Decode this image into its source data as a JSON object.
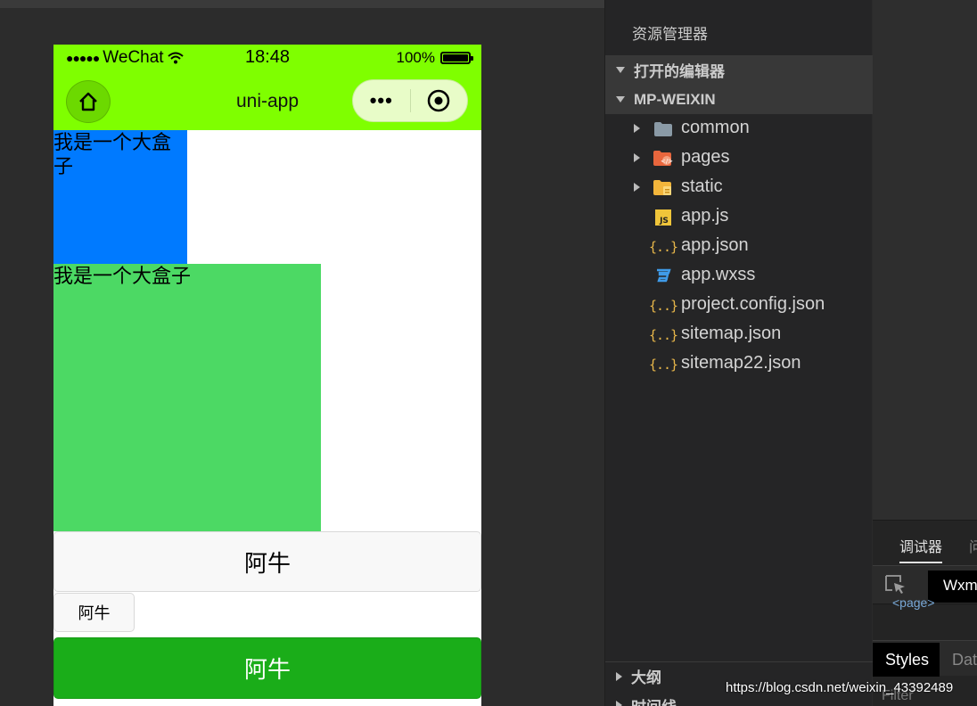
{
  "status_bar": {
    "carrier": "WeChat",
    "time": "18:48",
    "battery": "100%",
    "battery_level": 1.0
  },
  "nav_bar": {
    "title": "uni-app",
    "more_icon": "•••"
  },
  "content": {
    "blue_box_text": "我是一个大盒子",
    "green_box_text": "我是一个大盒子",
    "button_default": "阿牛",
    "button_mini": "阿牛",
    "button_primary": "阿牛"
  },
  "explorer": {
    "title": "资源管理器",
    "open_editors": "打开的编辑器",
    "project": "MP-WEIXIN",
    "files": [
      {
        "name": "common",
        "icon": "folder-icon"
      },
      {
        "name": "pages",
        "icon": "pages-folder-icon"
      },
      {
        "name": "static",
        "icon": "static-folder-icon"
      },
      {
        "name": "app.js",
        "icon": "js-icon"
      },
      {
        "name": "app.json",
        "icon": "json-icon"
      },
      {
        "name": "app.wxss",
        "icon": "css-icon"
      },
      {
        "name": "project.config.json",
        "icon": "json-icon"
      },
      {
        "name": "sitemap.json",
        "icon": "json-icon"
      },
      {
        "name": "sitemap22.json",
        "icon": "json-icon"
      }
    ],
    "outline": "大纲",
    "timeline": "时间线"
  },
  "devtools": {
    "tab_debugger": "调试器",
    "tab_next": "问",
    "wxml_tab": "Wxml",
    "page_tag": "<page>",
    "styles_tab": "Styles",
    "data_tab": "Data",
    "filter": "Filter"
  },
  "watermark": "https://blog.csdn.net/weixin_43392489",
  "colors": {
    "nav_green": "#7fff00",
    "blue_box": "#007aff",
    "green_box": "#4cd964",
    "primary_button": "#1aad19",
    "json_icon": "#e8b74a"
  }
}
